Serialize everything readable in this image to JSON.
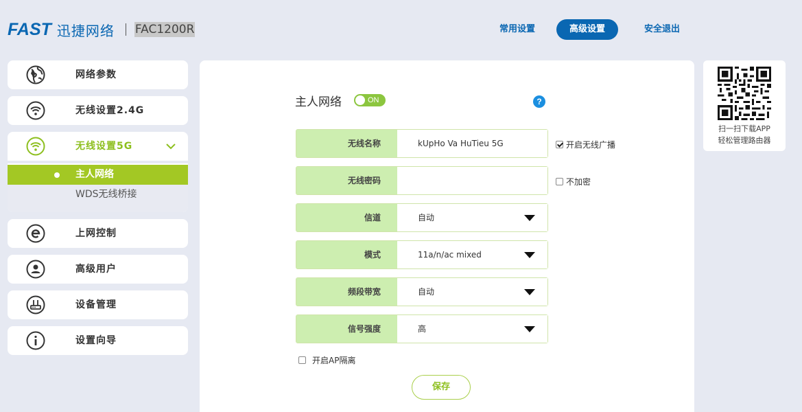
{
  "header": {
    "logo_brand": "FAST",
    "logo_cn": "迅捷网络",
    "model": "FAC1200R",
    "nav": {
      "common": "常用设置",
      "advanced": "高级设置",
      "logout": "安全退出"
    }
  },
  "sidebar": {
    "items": [
      {
        "label": "网络参数",
        "icon": "globe-icon"
      },
      {
        "label": "无线设置2.4G",
        "icon": "wifi-icon"
      },
      {
        "label": "无线设置5G",
        "icon": "wifi-icon"
      },
      {
        "label": "上网控制",
        "icon": "internet-explorer-icon"
      },
      {
        "label": "高级用户",
        "icon": "user-icon"
      },
      {
        "label": "设备管理",
        "icon": "router-icon"
      },
      {
        "label": "设置向导",
        "icon": "info-icon"
      }
    ],
    "submenu": [
      {
        "label": "主人网络"
      },
      {
        "label": "WDS无线桥接"
      }
    ]
  },
  "main": {
    "title": "主人网络",
    "toggle_label": "ON",
    "help": "?",
    "fields": [
      {
        "label": "无线名称",
        "value": "kUpHo Va HuTieu 5G"
      },
      {
        "label": "无线密码",
        "value": ""
      },
      {
        "label": "信道",
        "value": "自动"
      },
      {
        "label": "模式",
        "value": "11a/n/ac mixed"
      },
      {
        "label": "频段带宽",
        "value": "自动"
      },
      {
        "label": "信号强度",
        "value": "高"
      }
    ],
    "checkbox_broadcast": "开启无线广播",
    "checkbox_no_encrypt": "不加密",
    "checkbox_ap_isolation": "开启AP隔离",
    "save_label": "保存"
  },
  "qr": {
    "line1": "扫一扫下载APP",
    "line2": "轻松管理路由器"
  },
  "colors": {
    "brand_blue": "#0a67b2",
    "accent_green": "#8dbf1e",
    "active_sub_bg": "#a3c824",
    "field_label_bg": "#cdeeb0"
  }
}
